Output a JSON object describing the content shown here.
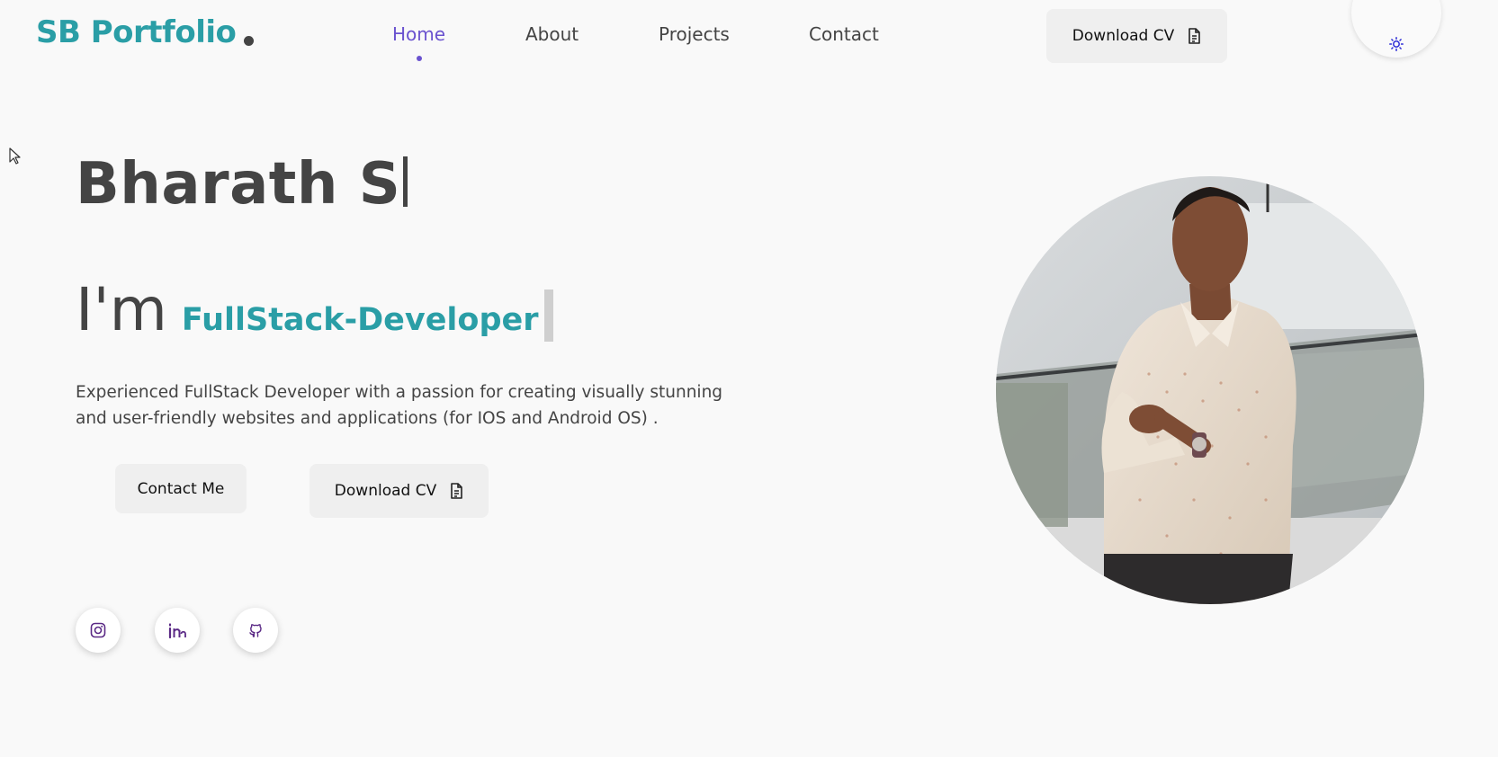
{
  "header": {
    "logo_text": "SB Portfolio",
    "nav": [
      {
        "label": "Home",
        "active": true
      },
      {
        "label": "About",
        "active": false
      },
      {
        "label": "Projects",
        "active": false
      },
      {
        "label": "Contact",
        "active": false
      }
    ],
    "download_cv_label": "Download CV",
    "theme_icon": "sun-icon"
  },
  "hero": {
    "name": "Bharath S",
    "im_text": "I'm",
    "role": "FullStack-Developer",
    "description": "Experienced FullStack Developer with a passion for creating visually stunning and user-friendly websites and applications (for IOS and Android OS) .",
    "contact_button_label": "Contact Me",
    "download_cv_label": "Download CV"
  },
  "social_icons": [
    "instagram-icon",
    "linkedin-icon",
    "github-icon"
  ],
  "colors": {
    "brand_teal": "#2a9ea6",
    "accent_purple": "#6a52cf",
    "text_dark": "#444444",
    "background": "#f9f9f9",
    "button_bg": "#efefef"
  }
}
